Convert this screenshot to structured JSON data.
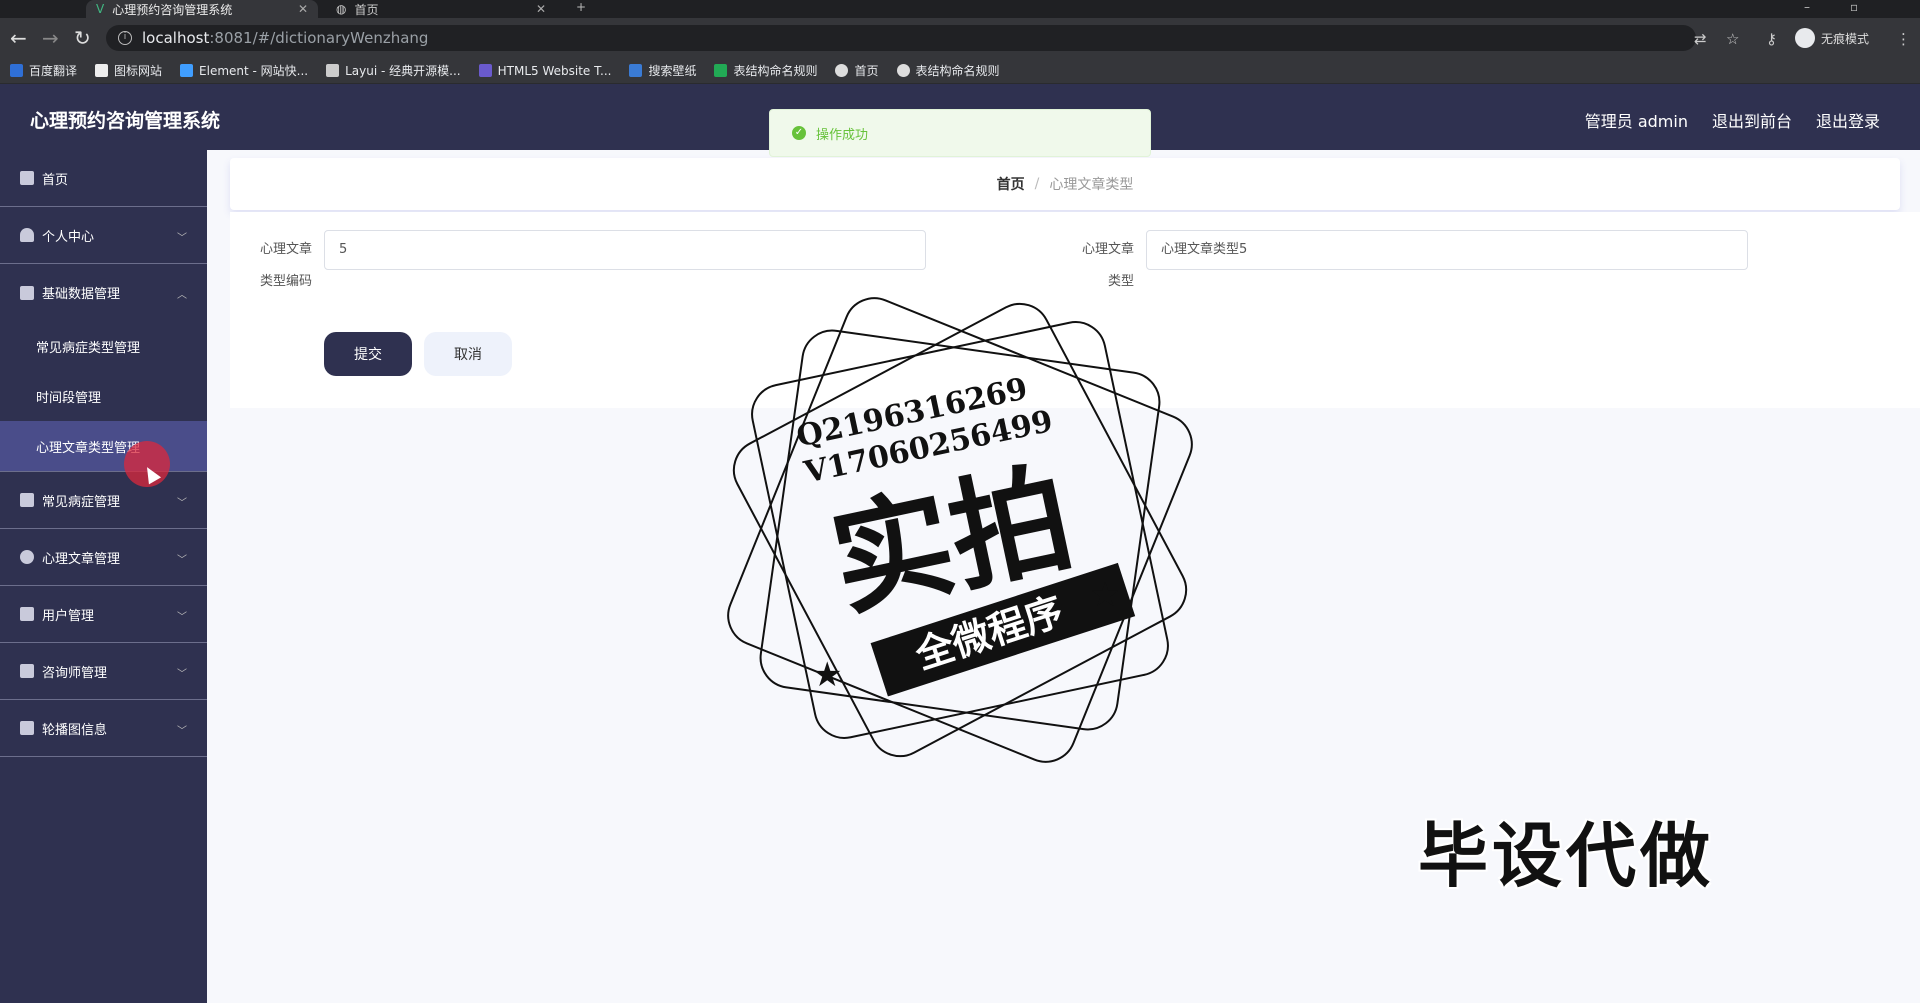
{
  "browser": {
    "tabs": [
      {
        "title": "心理预约咨询管理系统",
        "active": true
      },
      {
        "title": "首页",
        "active": false
      }
    ],
    "new_tab": "+",
    "url_host": "localhost",
    "url_path": ":8081/#/dictionaryWenzhang",
    "incognito_label": "无痕模式",
    "bookmarks": [
      {
        "label": "百度翻译",
        "color": "#2f6fd6"
      },
      {
        "label": "图标网站",
        "color": "#eeeeee"
      },
      {
        "label": "Element - 网站快...",
        "color": "#409eff"
      },
      {
        "label": "Layui - 经典开源模...",
        "color": "#cccccc"
      },
      {
        "label": "HTML5 Website T...",
        "color": "#6a5acd"
      },
      {
        "label": "搜索壁纸",
        "color": "#3a7bd5"
      },
      {
        "label": "表结构命名规则",
        "color": "#22aa55"
      },
      {
        "label": "首页",
        "color": "#dddddd"
      },
      {
        "label": "表结构命名规则",
        "color": "#dddddd"
      }
    ]
  },
  "header": {
    "title": "心理预约咨询管理系统",
    "admin_label": "管理员 admin",
    "front_link": "退出到前台",
    "logout_link": "退出登录"
  },
  "toast": {
    "message": "操作成功"
  },
  "sidebar": {
    "home": "首页",
    "personal": "个人中心",
    "basic": "基础数据管理",
    "basic_sub": [
      "常见病症类型管理",
      "时间段管理",
      "心理文章类型管理"
    ],
    "disease": "常见病症管理",
    "article": "心理文章管理",
    "users": "用户管理",
    "counselors": "咨询师管理",
    "carousel": "轮播图信息"
  },
  "breadcrumb": {
    "home": "首页",
    "separator": "/",
    "current": "心理文章类型"
  },
  "form": {
    "field1_label_line1": "心理文章",
    "field1_label_line2": "类型编码",
    "field1_value": "5",
    "field2_label_line1": "心理文章",
    "field2_label_line2": "类型",
    "field2_value": "心理文章类型5",
    "submit": "提交",
    "cancel": "取消"
  },
  "watermark": {
    "qq": "Q2196316269",
    "wx": "V1706025649​9",
    "big": "实拍",
    "ribbon": "全微程序",
    "side_text": "毕设代做"
  }
}
